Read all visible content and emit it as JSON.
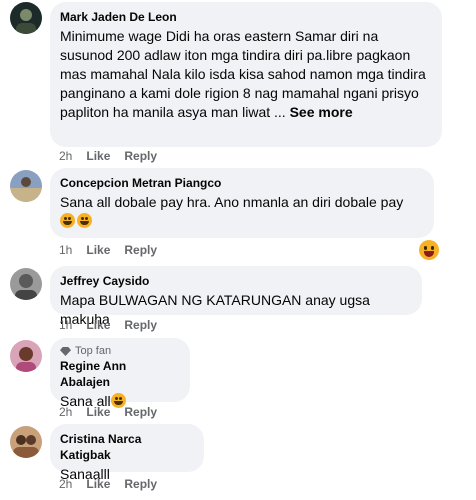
{
  "comments": [
    {
      "name": "Mark Jaden De Leon",
      "text": "Minimume wage Didi ha oras eastern Samar diri na susunod 200 adlaw iton mga tindira diri pa.libre pagkaon mas mamahal Nala kilo isda kisa sahod namon mga tindira panginano a kami dole rigion 8 nag mamahal ngani prisyo papliton ha manila asya man liwat ...",
      "see_more": "See more",
      "time": "2h",
      "like": "Like",
      "reply": "Reply"
    },
    {
      "name": "Concepcion Metran Piangco",
      "text": "Sana all dobale pay hra. Ano nmanla an diri dobale pay",
      "time": "1h",
      "like": "Like",
      "reply": "Reply"
    },
    {
      "name": "Jeffrey Caysido",
      "text": "Mapa BULWAGAN NG KATARUNGAN anay ugsa makuha",
      "time": "1h",
      "like": "Like",
      "reply": "Reply"
    },
    {
      "badge": "Top fan",
      "name": "Regine Ann Abalajen",
      "text": "Sana all",
      "time": "2h",
      "like": "Like",
      "reply": "Reply"
    },
    {
      "name": "Cristina Narca Katigbak",
      "text": "Sanaalll",
      "time": "2h",
      "like": "Like",
      "reply": "Reply"
    }
  ]
}
